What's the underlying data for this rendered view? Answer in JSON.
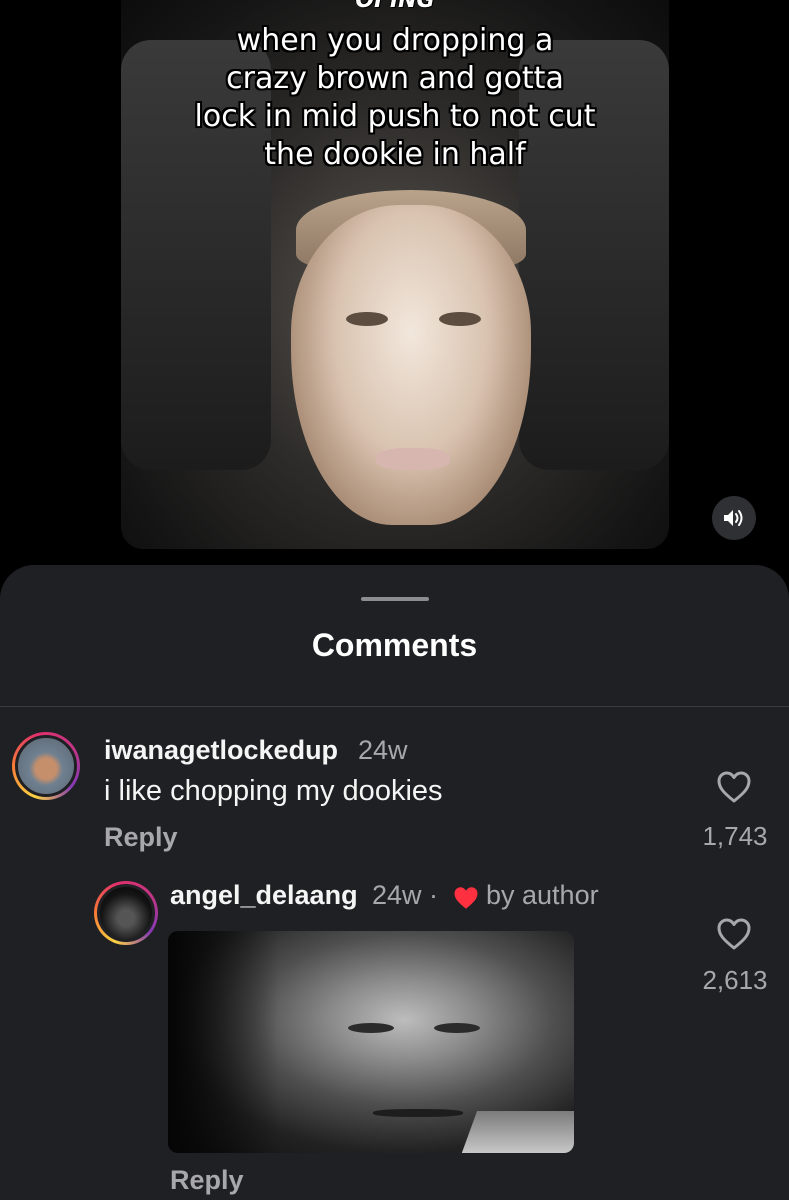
{
  "video": {
    "caption_top_cut": "OI ING",
    "caption": "when you dropping a\ncrazy brown and gotta\nlock in mid push to not cut\nthe dookie in half",
    "sound_icon": "speaker-unmuted-icon"
  },
  "comments_sheet": {
    "title": "Comments",
    "comments": [
      {
        "username": "iwanagetlockedup",
        "age": "24w",
        "text": "i like chopping my dookies",
        "reply_label": "Reply",
        "like_count": "1,743",
        "like_icon": "heart-outline-icon"
      },
      {
        "username": "angel_delaang",
        "age": "24w ·",
        "author_badge": "by author",
        "author_like_icon": "heart-filled-icon",
        "reply_label": "Reply",
        "like_count": "2,613",
        "like_icon": "heart-outline-icon"
      }
    ]
  },
  "colors": {
    "sheet_bg": "#1f2023",
    "secondary_text": "#a8a8ab",
    "heart_red": "#ff3040"
  }
}
